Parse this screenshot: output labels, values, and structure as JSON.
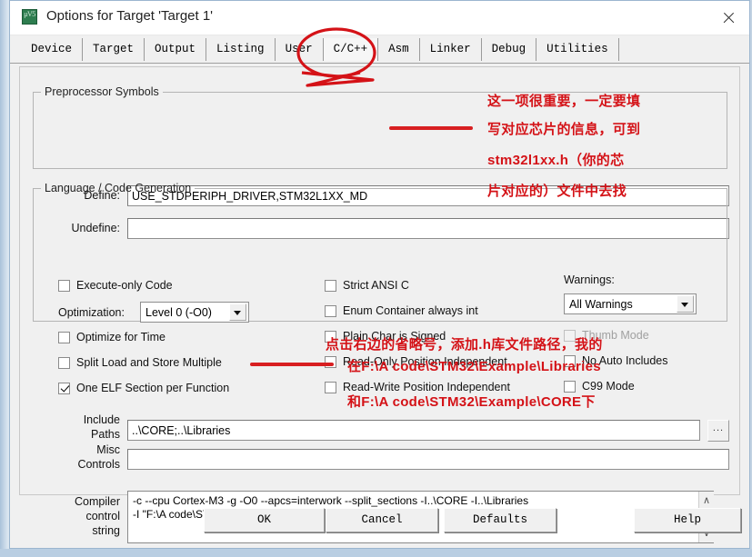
{
  "window": {
    "title": "Options for Target 'Target 1'",
    "icon": "keil-uvision-icon",
    "close_label": "close-icon"
  },
  "tabs": [
    {
      "label": "Device",
      "active": false
    },
    {
      "label": "Target",
      "active": false
    },
    {
      "label": "Output",
      "active": false
    },
    {
      "label": "Listing",
      "active": false
    },
    {
      "label": "User",
      "active": false
    },
    {
      "label": "C/C++",
      "active": true
    },
    {
      "label": "Asm",
      "active": false
    },
    {
      "label": "Linker",
      "active": false
    },
    {
      "label": "Debug",
      "active": false
    },
    {
      "label": "Utilities",
      "active": false
    }
  ],
  "preprocessor": {
    "legend": "Preprocessor Symbols",
    "define_label": "Define:",
    "define_value": "USE_STDPERIPH_DRIVER,STM32L1XX_MD",
    "undefine_label": "Undefine:",
    "undefine_value": ""
  },
  "language": {
    "legend": "Language / Code Generation",
    "left_column": [
      {
        "label": "Execute-only Code",
        "checked": false,
        "disabled": false
      },
      {
        "label": "Optimize for Time",
        "checked": false,
        "disabled": false
      },
      {
        "label": "Split Load and Store Multiple",
        "checked": false,
        "disabled": false
      },
      {
        "label": "One ELF Section per Function",
        "checked": true,
        "disabled": false
      }
    ],
    "optimization_label": "Optimization:",
    "optimization_value": "Level 0 (-O0)",
    "middle_column": [
      {
        "label": "Strict ANSI C",
        "checked": false,
        "disabled": false
      },
      {
        "label": "Enum Container always int",
        "checked": false,
        "disabled": false
      },
      {
        "label": "Plain Char is Signed",
        "checked": false,
        "disabled": false
      },
      {
        "label": "Read-Only Position Independent",
        "checked": false,
        "disabled": false
      },
      {
        "label": "Read-Write Position Independent",
        "checked": false,
        "disabled": false
      }
    ],
    "warnings_label": "Warnings:",
    "warnings_value": "All Warnings",
    "right_column": [
      {
        "label": "Thumb Mode",
        "checked": false,
        "disabled": true
      },
      {
        "label": "No Auto Includes",
        "checked": false,
        "disabled": false
      },
      {
        "label": "C99 Mode",
        "checked": false,
        "disabled": false
      }
    ]
  },
  "paths": {
    "include_label_line1": "Include",
    "include_label_line2": "Paths",
    "include_value": "..\\CORE;..\\Libraries",
    "browse_label": "...",
    "misc_label_line1": "Misc",
    "misc_label_line2": "Controls",
    "misc_value": "",
    "compiler_label_line1": "Compiler",
    "compiler_label_line2": "control",
    "compiler_label_line3": "string",
    "compiler_value": "-c --cpu Cortex-M3 -g -O0 --apcs=interwork --split_sections -I..\\CORE -I..\\Libraries\n-I \"F:\\A code\\STM32\\Example\\Project\\RTE\"",
    "scroll_up": "∧",
    "scroll_down": "∨"
  },
  "buttons": [
    {
      "label": "OK"
    },
    {
      "label": "Cancel"
    },
    {
      "label": "Defaults"
    },
    {
      "label": "Help"
    }
  ],
  "annotations": {
    "color": "#d41217",
    "note1": "这一项很重要，一定要填",
    "note2": "写对应芯片的信息，可到",
    "note3": "stm32l1xx.h（你的芯",
    "note4": "片对应的）文件中去找",
    "note5": "点击右边的省略号，添加.h库文件路径，我的",
    "note6": "在F:\\A code\\STM32\\Example\\Libraries",
    "note7": "和F:\\A code\\STM32\\Example\\CORE下",
    "circle_target": "C/C++ tab",
    "underline_targets": [
      "define-field",
      "include-paths-field"
    ]
  }
}
